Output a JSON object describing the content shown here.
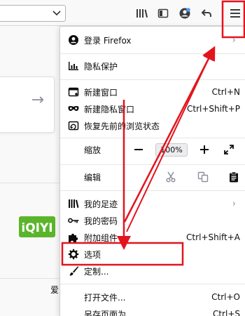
{
  "colors": {
    "annotation_red": "#e3141d",
    "iqiyi_green": "#5bb52a",
    "menu_background": "#ffffff",
    "toolbar_background": "#f9f9fa"
  },
  "toolbar": {
    "icons": [
      "library-icon",
      "sidebar-icon",
      "account-icon",
      "back-arrow-icon",
      "hamburger-menu-icon"
    ]
  },
  "page": {
    "tile_logo_text": "iQIYI",
    "tile_caption": "爱"
  },
  "menu": {
    "sign_in": "登录 Firefox",
    "privacy": "隐私保护",
    "new_window": {
      "label": "新建窗口",
      "shortcut": "Ctrl+N"
    },
    "new_private_window": {
      "label": "新建隐私窗口",
      "shortcut": "Ctrl+Shift+P"
    },
    "restore_session": "恢复先前的浏览状态",
    "zoom": {
      "label": "缩放",
      "value": "100%"
    },
    "edit": {
      "label": "编辑"
    },
    "library": "我的足迹",
    "logins": "我的密码",
    "addons": {
      "label": "附加组件",
      "shortcut": "Ctrl+Shift+A"
    },
    "options": "选项",
    "customize": "定制...",
    "open_file": {
      "label": "打开文件...",
      "shortcut": "Ctrl+O"
    },
    "save_page": {
      "label": "另存页面为...",
      "shortcut": "Ctrl+S"
    }
  }
}
